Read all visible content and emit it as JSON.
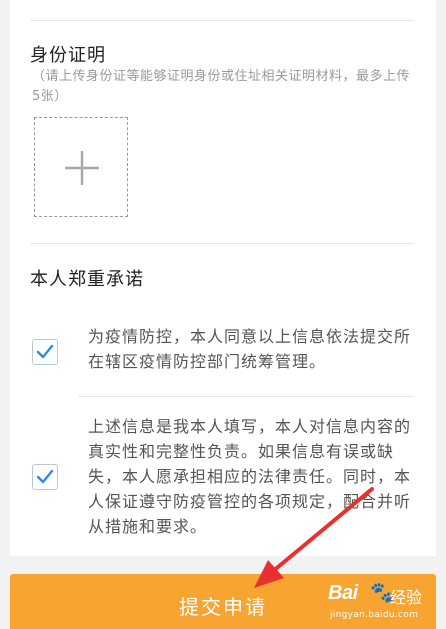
{
  "id_proof": {
    "title": "身份证明",
    "hint": "（请上传身份证等能够证明身份或住址相关证明材料，最多上传5张）"
  },
  "promise": {
    "title": "本人郑重承诺",
    "items": [
      {
        "checked": true,
        "text": "为疫情防控，本人同意以上信息依法提交所在辖区疫情防控部门统筹管理。"
      },
      {
        "checked": true,
        "text": "上述信息是我本人填写，本人对信息内容的真实性和完整性负责。如果信息有误或缺失，本人愿承担相应的法律责任。同时，本人保证遵守防疫管控的各项规定，配合并听从措施和要求。"
      }
    ]
  },
  "submit": {
    "label": "提交申请"
  },
  "colors": {
    "accent": "#f7a431",
    "check": "#2f8be8",
    "annotation": "#e8302f"
  },
  "icons": {
    "upload": "plus-icon",
    "checkbox": "checkmark-icon",
    "annotation": "arrow-icon"
  }
}
